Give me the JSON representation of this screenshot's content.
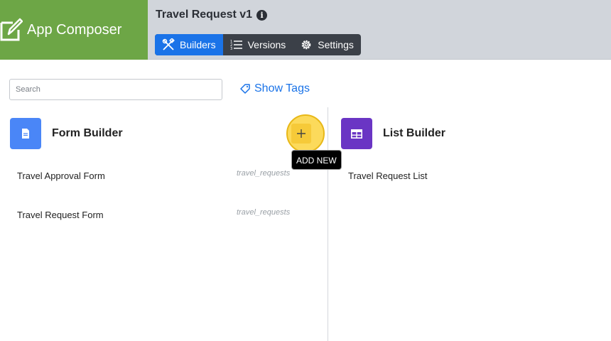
{
  "brand": {
    "name": "App Composer",
    "icon": "edit-icon",
    "color": "#6da646"
  },
  "app": {
    "title": "Travel Request v1",
    "info_icon": "info-icon"
  },
  "tabs": [
    {
      "label": "Builders",
      "icon": "tools-icon",
      "active": true
    },
    {
      "label": "Versions",
      "icon": "list-numbered-icon",
      "active": false
    },
    {
      "label": "Settings",
      "icon": "gear-icon",
      "active": false
    }
  ],
  "search": {
    "placeholder": "Search",
    "value": ""
  },
  "show_tags": {
    "label": "Show Tags",
    "icon": "tag-icon"
  },
  "form_builder": {
    "title": "Form Builder",
    "icon": "document-icon",
    "color": "#4a86f7",
    "add_tooltip": "ADD NEW",
    "items": [
      {
        "title": "Travel Approval Form",
        "tag": "travel_requests"
      },
      {
        "title": "Travel Request Form",
        "tag": "travel_requests"
      }
    ]
  },
  "list_builder": {
    "title": "List Builder",
    "icon": "table-icon",
    "color": "#6a35c4",
    "items": [
      {
        "title": "Travel Request List"
      }
    ]
  },
  "colors": {
    "accent": "#1a73e8",
    "topbar": "#d1d5db",
    "tabs_bg": "#3b4048",
    "highlight": "#fcd33e"
  }
}
